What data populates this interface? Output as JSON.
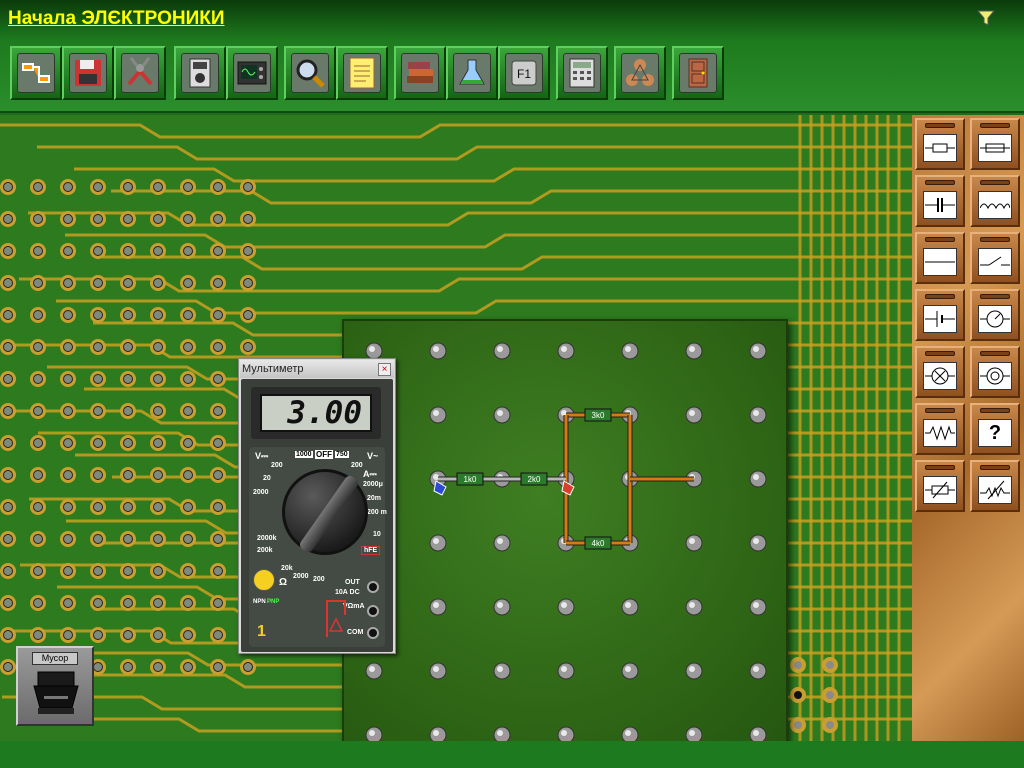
{
  "app": {
    "title": "Начала ЭЛЄКТРОНИКИ"
  },
  "toolbar": {
    "buttons": [
      {
        "name": "circuit-wizard",
        "icon": "schematic-icon"
      },
      {
        "name": "save",
        "icon": "floppy-disk-icon"
      },
      {
        "name": "tools",
        "icon": "pliers-icon"
      },
      {
        "name": "multimeter",
        "icon": "multimeter-icon"
      },
      {
        "name": "oscilloscope",
        "icon": "oscilloscope-icon"
      },
      {
        "name": "magnifier",
        "icon": "magnifier-icon"
      },
      {
        "name": "notes",
        "icon": "notepad-icon"
      },
      {
        "name": "library",
        "icon": "books-icon"
      },
      {
        "name": "lab",
        "icon": "flask-icon"
      },
      {
        "name": "help",
        "icon": "f1-key-icon"
      },
      {
        "name": "calculator",
        "icon": "calculator-icon"
      },
      {
        "name": "molecule",
        "icon": "molecule-icon"
      },
      {
        "name": "exit",
        "icon": "door-icon"
      }
    ]
  },
  "circuit": {
    "resistors": [
      {
        "label": "1k0"
      },
      {
        "label": "2k0"
      },
      {
        "label": "3k0"
      },
      {
        "label": "4k0"
      }
    ]
  },
  "multimeter": {
    "title": "Мультиметр",
    "close": "×",
    "reading": "3.00",
    "index": "1",
    "labels": {
      "vdc": "V⎓",
      "vac": "V~",
      "off": "OFF",
      "r1000": "1000",
      "r750": "750",
      "r200a": "200",
      "r20a": "20",
      "r2000a": "2000",
      "m200": "200",
      "amp": "A⎓",
      "a2000": "2000μ",
      "a20m": "20m",
      "a200m": "200\nm",
      "a10": "10",
      "hfe": "hFE",
      "k2000": "2000k",
      "k200": "200k",
      "k20": "20k",
      "k2": "2000",
      "ohm": "Ω",
      "r200b": "200",
      "npn": "NPN",
      "pnp": "PNP",
      "out": "OUT",
      "ten_a": "10A DC",
      "v_omega": "VΩmA",
      "com": "COM"
    }
  },
  "trash": {
    "label": "Мусор"
  },
  "components": {
    "items": [
      {
        "name": "resistor",
        "icon": "resistor-icon"
      },
      {
        "name": "fuse",
        "icon": "fuse-icon"
      },
      {
        "name": "capacitor",
        "icon": "capacitor-icon"
      },
      {
        "name": "inductor",
        "icon": "inductor-icon"
      },
      {
        "name": "wire",
        "icon": "wire-icon"
      },
      {
        "name": "switch",
        "icon": "switch-icon"
      },
      {
        "name": "battery",
        "icon": "battery-icon"
      },
      {
        "name": "voltmeter",
        "icon": "gauge-icon"
      },
      {
        "name": "lamp",
        "icon": "lamp-icon"
      },
      {
        "name": "coil",
        "icon": "coil-icon"
      },
      {
        "name": "variable-resistor",
        "icon": "zigzag-icon"
      },
      {
        "name": "unknown",
        "icon": "question-icon",
        "text": "?"
      },
      {
        "name": "rheostat",
        "icon": "rheostat-icon"
      },
      {
        "name": "potentiometer",
        "icon": "potentiometer-icon"
      }
    ]
  },
  "colors": {
    "title": "#ffff00",
    "pcb": "#2d7a1f",
    "trace": "#c8a020",
    "board": "#2c6214",
    "lcd": "#c9cfc4"
  }
}
